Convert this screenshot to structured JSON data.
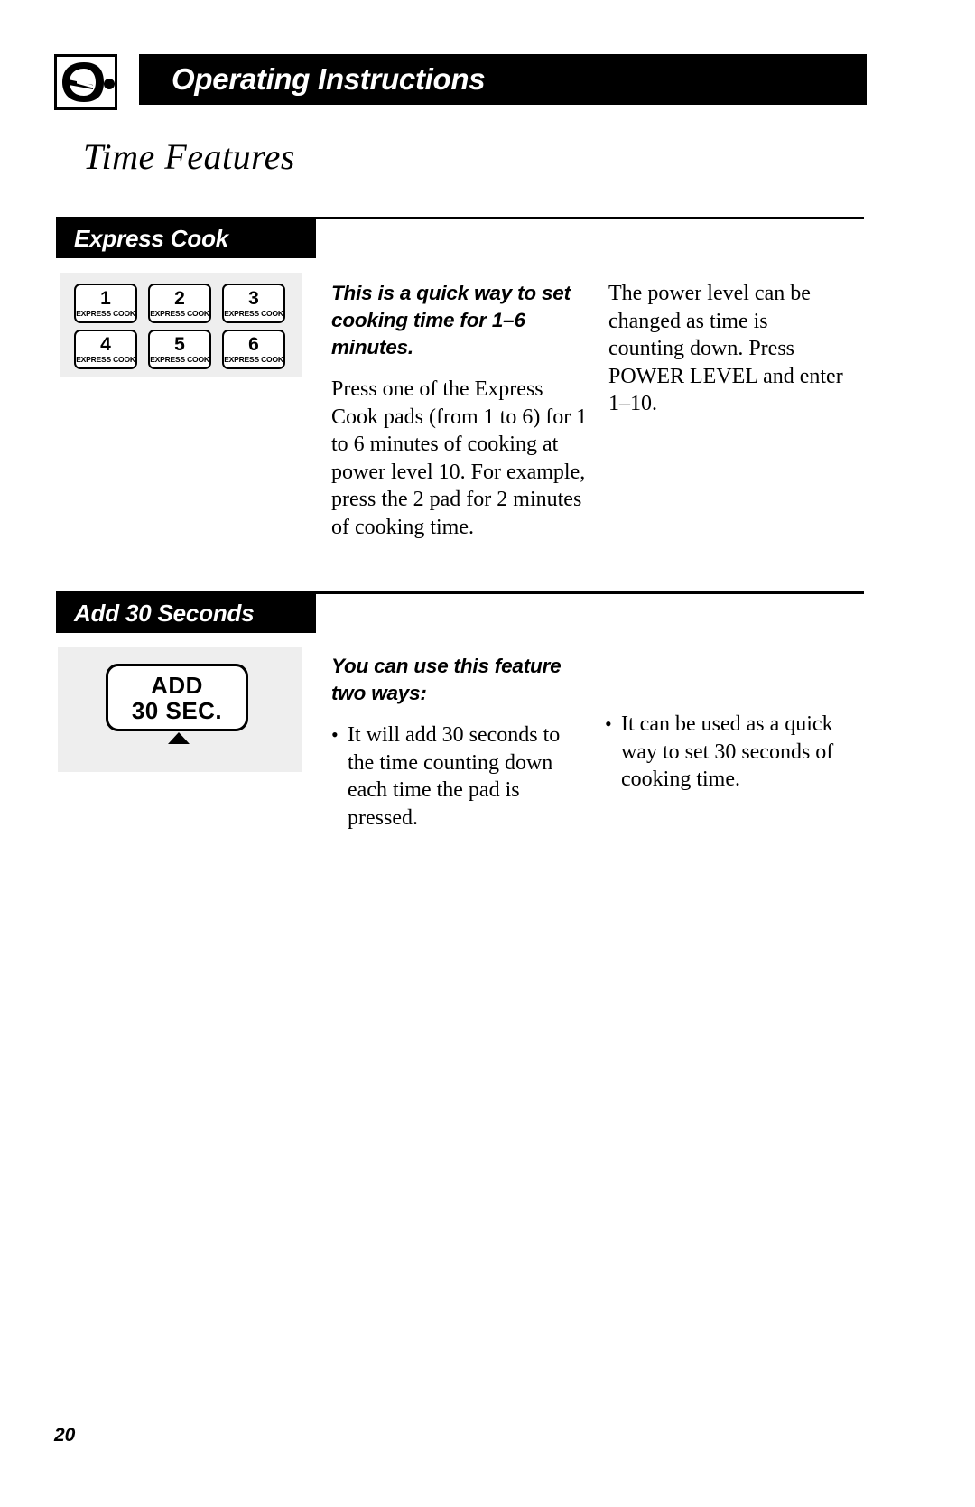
{
  "header": {
    "icon_name": "microwave-door-icon",
    "title": "Operating Instructions"
  },
  "page_title": "Time Features",
  "sections": [
    {
      "id": "express-cook",
      "tab_label": "Express Cook",
      "keypad": {
        "keys": [
          {
            "number": "1",
            "sublabel": "EXPRESS COOK"
          },
          {
            "number": "2",
            "sublabel": "EXPRESS COOK"
          },
          {
            "number": "3",
            "sublabel": "EXPRESS COOK"
          },
          {
            "number": "4",
            "sublabel": "EXPRESS COOK"
          },
          {
            "number": "5",
            "sublabel": "EXPRESS COOK"
          },
          {
            "number": "6",
            "sublabel": "EXPRESS COOK"
          }
        ]
      },
      "column_left": {
        "lead": "This is a quick way to set cooking time for 1–6 minutes.",
        "paragraph": "Press one of the Express Cook pads (from 1 to 6) for 1 to 6 minutes of cooking at power level 10. For example, press the 2 pad for 2 minutes of cooking time."
      },
      "column_right": {
        "paragraph": "The power level can be changed as time is counting down. Press POWER LEVEL and enter 1–10."
      }
    },
    {
      "id": "add-30-seconds",
      "tab_label": "Add 30 Seconds",
      "pad": {
        "line1": "ADD",
        "line2": "30 SEC.",
        "marker": "up-triangle-marker"
      },
      "column_left": {
        "lead": "You can use this feature two ways:",
        "bullets": [
          "It will add 30 seconds to the time counting down each time the pad is pressed."
        ]
      },
      "column_right": {
        "bullets": [
          "It can be used as a quick way to set 30 seconds of cooking time."
        ]
      }
    }
  ],
  "page_number": "20"
}
